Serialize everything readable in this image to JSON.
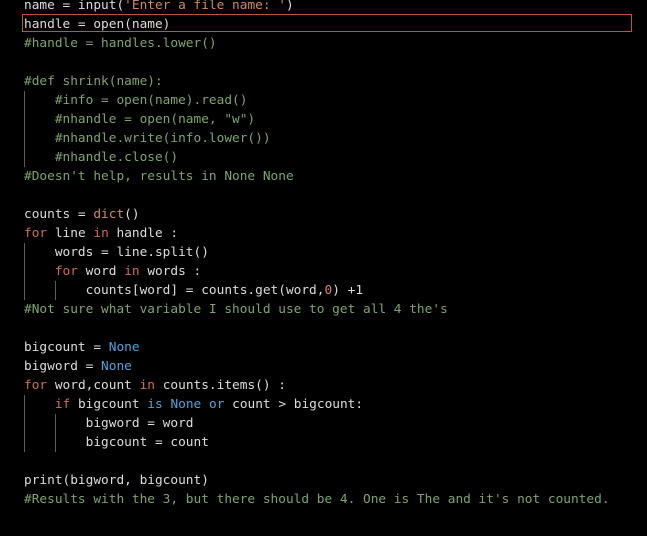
{
  "editor": {
    "lines": [
      [
        {
          "t": "name = input(",
          "c": "var"
        },
        {
          "t": "'Enter a file name: '",
          "c": "str"
        },
        {
          "t": ")",
          "c": "var"
        }
      ],
      [
        {
          "t": "handle = open(name)",
          "c": "var"
        }
      ],
      [
        {
          "t": "#handle = handles.lower()",
          "c": "cmt"
        }
      ],
      [],
      [
        {
          "t": "#def shrink(name):",
          "c": "cmt"
        }
      ],
      [
        {
          "t": "    #info = open(name).read()",
          "c": "cmt"
        }
      ],
      [
        {
          "t": "    #nhandle = open(name, \"w\")",
          "c": "cmt"
        }
      ],
      [
        {
          "t": "    #nhandle.write(info.lower())",
          "c": "cmt"
        }
      ],
      [
        {
          "t": "    #nhandle.close()",
          "c": "cmt"
        }
      ],
      [
        {
          "t": "#Doesn't help, results in None None",
          "c": "cmt"
        }
      ],
      [],
      [
        {
          "t": "counts = ",
          "c": "var"
        },
        {
          "t": "dict",
          "c": "func"
        },
        {
          "t": "()",
          "c": "var"
        }
      ],
      [
        {
          "t": "for",
          "c": "kw"
        },
        {
          "t": " line ",
          "c": "var"
        },
        {
          "t": "in",
          "c": "kw"
        },
        {
          "t": " handle :",
          "c": "var"
        }
      ],
      [
        {
          "t": "    words = line.split()",
          "c": "var"
        }
      ],
      [
        {
          "t": "    ",
          "c": "var"
        },
        {
          "t": "for",
          "c": "kw"
        },
        {
          "t": " word ",
          "c": "var"
        },
        {
          "t": "in",
          "c": "kw"
        },
        {
          "t": " words :",
          "c": "var"
        }
      ],
      [
        {
          "t": "        counts[word] = counts.get(word,",
          "c": "var"
        },
        {
          "t": "0",
          "c": "num"
        },
        {
          "t": ") +1",
          "c": "var"
        }
      ],
      [
        {
          "t": "#Not sure what variable I should use to get all 4 the's",
          "c": "cmt"
        }
      ],
      [],
      [
        {
          "t": "bigcount = ",
          "c": "var"
        },
        {
          "t": "None",
          "c": "const"
        }
      ],
      [
        {
          "t": "bigword = ",
          "c": "var"
        },
        {
          "t": "None",
          "c": "const"
        }
      ],
      [
        {
          "t": "for",
          "c": "kw"
        },
        {
          "t": " word,count ",
          "c": "var"
        },
        {
          "t": "in",
          "c": "kw"
        },
        {
          "t": " counts.items() :",
          "c": "var"
        }
      ],
      [
        {
          "t": "    ",
          "c": "var"
        },
        {
          "t": "if",
          "c": "kw"
        },
        {
          "t": " bigcount ",
          "c": "var"
        },
        {
          "t": "is",
          "c": "const"
        },
        {
          "t": " ",
          "c": "var"
        },
        {
          "t": "None",
          "c": "const"
        },
        {
          "t": " ",
          "c": "var"
        },
        {
          "t": "or",
          "c": "const"
        },
        {
          "t": " count > bigcount:",
          "c": "var"
        }
      ],
      [
        {
          "t": "        bigword = word",
          "c": "var"
        }
      ],
      [
        {
          "t": "        bigcount = count",
          "c": "var"
        }
      ],
      [],
      [
        {
          "t": "print(bigword, bigcount)",
          "c": "var"
        }
      ],
      [
        {
          "t": "#Results with the 3, but there should be 4. One is The and it's not counted.",
          "c": "cmt"
        }
      ]
    ]
  }
}
